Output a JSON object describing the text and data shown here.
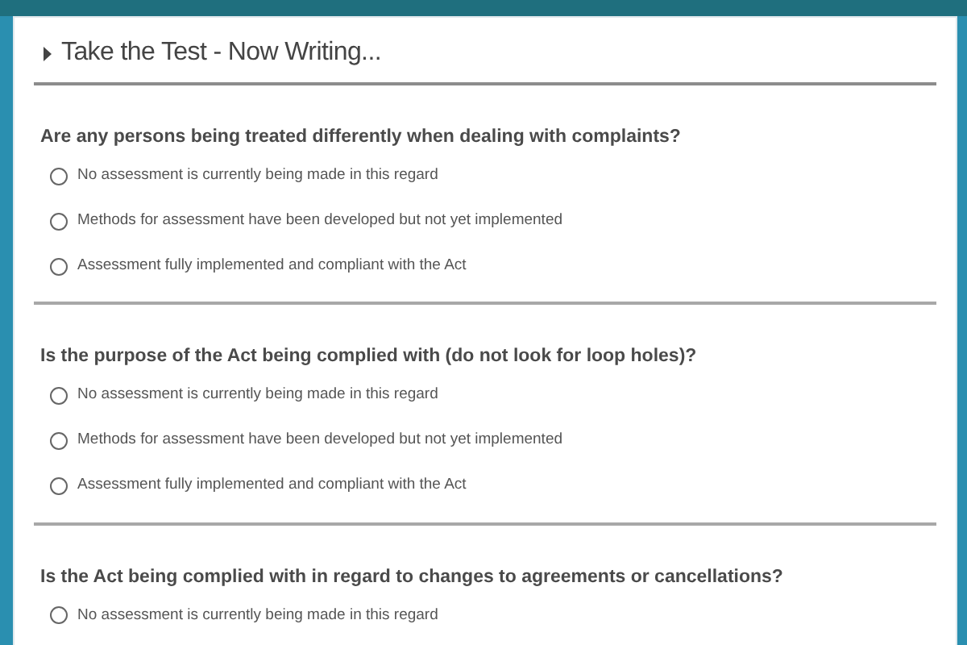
{
  "title": "Take the Test - Now Writing...",
  "questions": [
    {
      "text": "Are any persons being treated differently when dealing with complaints?",
      "options": [
        {
          "label": "No assessment is currently being made in this regard",
          "selected": false
        },
        {
          "label": "Methods for assessment have been developed but not yet implemented",
          "selected": false
        },
        {
          "label": "Assessment fully implemented and compliant with the Act",
          "selected": false
        }
      ]
    },
    {
      "text": "Is the purpose of the Act being complied with (do not look for loop holes)?",
      "options": [
        {
          "label": "No assessment is currently being made in this regard",
          "selected": false
        },
        {
          "label": "Methods for assessment have been developed but not yet implemented",
          "selected": false
        },
        {
          "label": "Assessment fully implemented and compliant with the Act",
          "selected": false
        }
      ]
    },
    {
      "text": "Is the Act being complied with in regard to changes to agreements or cancellations?",
      "options": [
        {
          "label": "No assessment is currently being made in this regard",
          "selected": false
        }
      ]
    }
  ]
}
